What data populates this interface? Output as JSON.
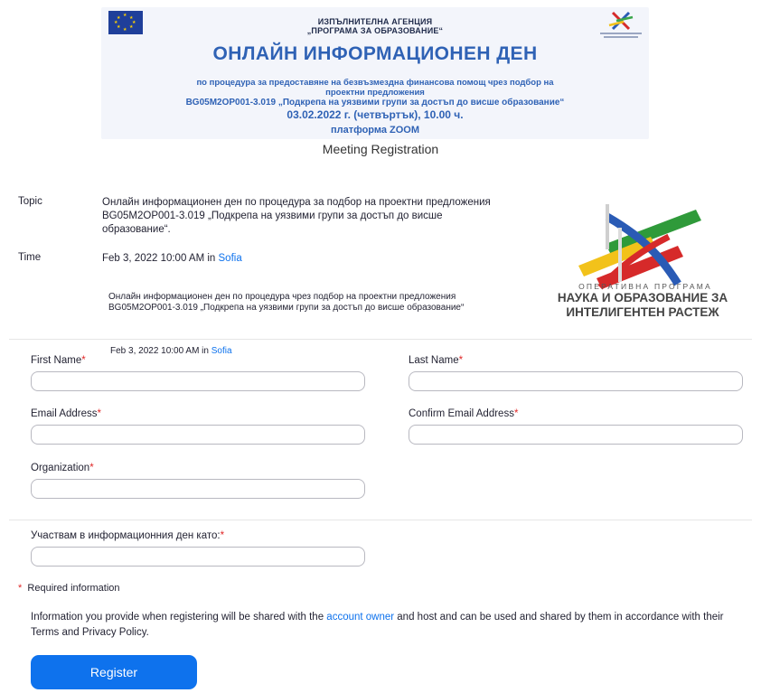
{
  "banner": {
    "agency_line1": "ИЗПЪЛНИТЕЛНА АГЕНЦИЯ",
    "agency_line2": "„ПРОГРАМА ЗА ОБРАЗОВАНИЕ“",
    "title": "ОНЛАЙН ИНФОРМАЦИОНЕН ДЕН",
    "line1": "по процедура за предоставяне на безвъзмездна финансова помощ чрез подбор на",
    "line2": "проектни предложения",
    "line3": "BG05M2OP001-3.019 „Подкрепа на уязвими групи за достъп до висше образование“",
    "date_line": "03.02.2022 г. (четвъртък), 10.00 ч.",
    "platform_line": "платформа ZOOM"
  },
  "heading": "Meeting Registration",
  "topic": {
    "label": "Topic",
    "value": "Онлайн информационен ден по процедура за подбор на проектни предложения BG05M2OP001-3.019 „Подкрепа на уязвими групи за достъп до висше образование“."
  },
  "time": {
    "label": "Time",
    "value": "Feb 3, 2022 10:00 AM in ",
    "tz": "Sofia"
  },
  "program_logo": {
    "small": "ОПЕРАТИВНА ПРОГРАМА",
    "line1": "НАУКА И ОБРАЗОВАНИЕ ЗА",
    "line2": "ИНТЕЛИГЕНТЕН РАСТЕЖ"
  },
  "description": "Онлайн информационен ден по процедура чрез подбор на проектни предложения BG05M2OP001-3.019 „Подкрепа на уязвими групи за достъп до висше образование“",
  "date_overlay": {
    "text": "Feb 3, 2022 10:00 AM in ",
    "tz": "Sofia"
  },
  "form": {
    "first_name": "First Name",
    "last_name": "Last Name",
    "email": "Email Address",
    "confirm_email": "Confirm Email Address",
    "organization": "Organization",
    "participate": "Участвам в информационния ден като:",
    "required_mark": "*"
  },
  "required_info": "Required information",
  "info": {
    "before": "Information you provide when registering will be shared with the ",
    "link": "account owner",
    "after": " and host and can be used and shared by them in accordance with their Terms and Privacy Policy."
  },
  "register_label": "Register",
  "colors": {
    "primary": "#0e72ed",
    "banner_blue": "#2f62b5",
    "required": "#e02828"
  }
}
